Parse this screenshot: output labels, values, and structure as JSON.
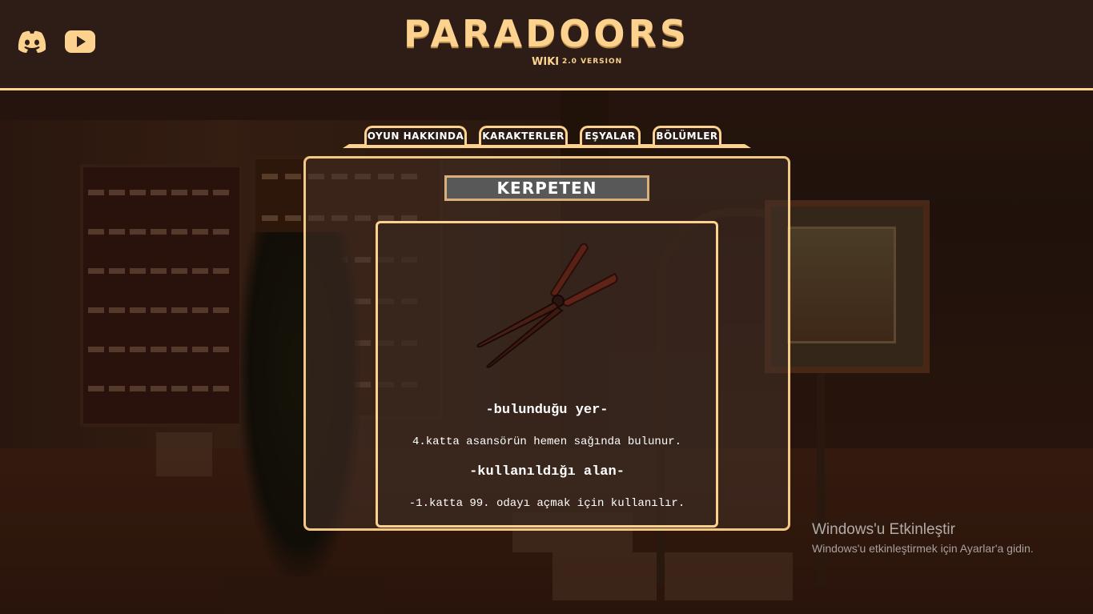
{
  "header": {
    "logo_title": "PARADOORS",
    "logo_subtitle": "WIKI",
    "logo_version": "2.0 VERSION",
    "social": [
      {
        "icon": "discord-icon"
      },
      {
        "icon": "youtube-icon"
      }
    ]
  },
  "tabs": [
    {
      "label": "OYUN HAKKINDA"
    },
    {
      "label": "KARAKTERLER"
    },
    {
      "label": "EŞYALAR"
    },
    {
      "label": "BÖLÜMLER"
    }
  ],
  "item": {
    "title": "KERPETEN",
    "image_icon": "pruning-shears-icon",
    "location_heading": "-bulunduğu yer-",
    "location_text": "4.katta asansörün hemen sağında bulunur.",
    "usage_heading": "-kullanıldığı alan-",
    "usage_text": "-1.katta 99. odayı açmak için kullanılır."
  },
  "watermark": {
    "title": "Windows'u Etkinleştir",
    "subtitle": "Windows'u etkinleştirmek için Ayarlar'a gidin."
  },
  "colors": {
    "accent": "#fcd28e",
    "title_box": "#585858"
  }
}
